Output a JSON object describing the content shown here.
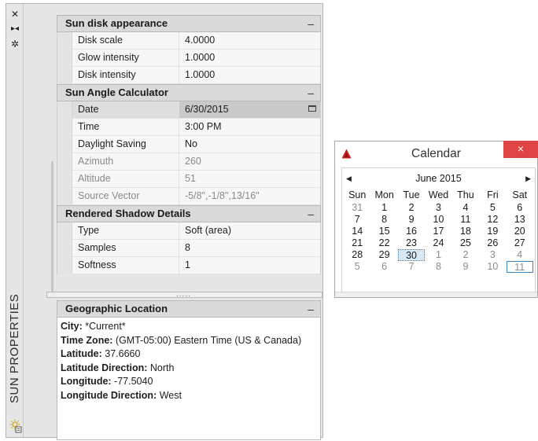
{
  "palette": {
    "title": "SUN PROPERTIES",
    "strip_icons": [
      "close-icon",
      "auto-hide-icon",
      "properties-icon"
    ],
    "sections": [
      {
        "title": "Sun disk appearance",
        "collapse": "–",
        "rows": [
          {
            "name": "Disk scale",
            "value": "4.0000"
          },
          {
            "name": "Glow intensity",
            "value": "1.0000"
          },
          {
            "name": "Disk intensity",
            "value": "1.0000"
          }
        ]
      },
      {
        "title": "Sun Angle Calculator",
        "collapse": "–",
        "rows": [
          {
            "name": "Date",
            "value": "6/30/2015"
          },
          {
            "name": "Time",
            "value": "3:00 PM"
          },
          {
            "name": "Daylight Saving",
            "value": "No"
          },
          {
            "name": "Azimuth",
            "value": "260"
          },
          {
            "name": "Altitude",
            "value": "51"
          },
          {
            "name": "Source Vector",
            "value": "-5/8\",-1/8\",13/16\""
          }
        ]
      },
      {
        "title": "Rendered Shadow Details",
        "collapse": "–",
        "rows": [
          {
            "name": "Type",
            "value": "Soft (area)"
          },
          {
            "name": "Samples",
            "value": "8"
          },
          {
            "name": "Softness",
            "value": "1"
          }
        ]
      }
    ],
    "splitter_grip": ".....",
    "geo": {
      "title": "Geographic Location",
      "collapse": "–",
      "lines": [
        {
          "label": "City:",
          "value": " *Current*"
        },
        {
          "label": "Time Zone:",
          "value": " (GMT-05:00) Eastern Time (US & Canada)"
        },
        {
          "label": "Latitude:",
          "value": " 37.6660"
        },
        {
          "label": "Latitude Direction:",
          "value": " North"
        },
        {
          "label": "Longitude:",
          "value": " -77.5040"
        },
        {
          "label": "Longitude Direction:",
          "value": " West"
        }
      ]
    }
  },
  "calendar": {
    "window_title": "Calendar",
    "close": "×",
    "month_label": "June 2015",
    "prev": "◀",
    "next": "▶",
    "weekdays": [
      "Sun",
      "Mon",
      "Tue",
      "Wed",
      "Thu",
      "Fri",
      "Sat"
    ],
    "weeks": [
      [
        {
          "d": "31",
          "o": true
        },
        {
          "d": "1"
        },
        {
          "d": "2"
        },
        {
          "d": "3"
        },
        {
          "d": "4"
        },
        {
          "d": "5"
        },
        {
          "d": "6"
        }
      ],
      [
        {
          "d": "7"
        },
        {
          "d": "8"
        },
        {
          "d": "9"
        },
        {
          "d": "10"
        },
        {
          "d": "11"
        },
        {
          "d": "12"
        },
        {
          "d": "13"
        }
      ],
      [
        {
          "d": "14"
        },
        {
          "d": "15"
        },
        {
          "d": "16"
        },
        {
          "d": "17"
        },
        {
          "d": "18"
        },
        {
          "d": "19"
        },
        {
          "d": "20"
        }
      ],
      [
        {
          "d": "21"
        },
        {
          "d": "22"
        },
        {
          "d": "23"
        },
        {
          "d": "24"
        },
        {
          "d": "25"
        },
        {
          "d": "26"
        },
        {
          "d": "27"
        }
      ],
      [
        {
          "d": "28"
        },
        {
          "d": "29"
        },
        {
          "d": "30",
          "sel": true
        },
        {
          "d": "1",
          "o": true
        },
        {
          "d": "2",
          "o": true
        },
        {
          "d": "3",
          "o": true
        },
        {
          "d": "4",
          "o": true
        }
      ],
      [
        {
          "d": "5",
          "o": true
        },
        {
          "d": "6",
          "o": true
        },
        {
          "d": "7",
          "o": true
        },
        {
          "d": "8",
          "o": true
        },
        {
          "d": "9",
          "o": true
        },
        {
          "d": "10",
          "o": true
        },
        {
          "d": "11",
          "o": true,
          "today": true
        }
      ]
    ],
    "colors": {
      "close": "#e04343",
      "accent": "#3c86c8",
      "app_icon": "#c8201e"
    }
  }
}
